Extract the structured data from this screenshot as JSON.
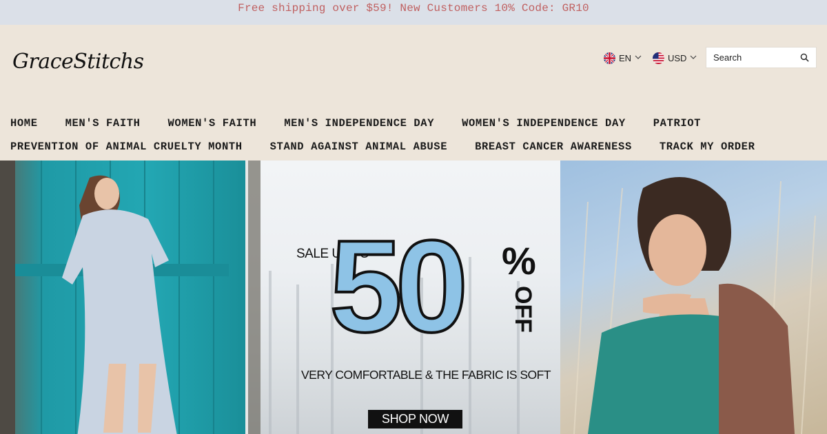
{
  "announcement": "Free shipping over $59! New Customers 10% Code: GR10",
  "brand": {
    "logo_text": "GraceStitchs"
  },
  "header": {
    "language": {
      "label": "EN",
      "flag_icon": "uk-flag-icon"
    },
    "currency": {
      "label": "USD",
      "flag_icon": "us-flag-icon"
    },
    "search": {
      "placeholder": "Search",
      "icon": "search-icon"
    }
  },
  "nav": {
    "row1": [
      "HOME",
      "MEN'S FAITH",
      "WOMEN'S FAITH",
      "MEN'S INDEPENDENCE DAY",
      "WOMEN'S INDEPENDENCE DAY",
      "PATRIOT"
    ],
    "row2": [
      "PREVENTION OF ANIMAL CRUELTY MONTH",
      "STAND AGAINST ANIMAL ABUSE",
      "BREAST CANCER AWARENESS",
      "TRACK MY ORDER"
    ]
  },
  "hero": {
    "sale_prefix": "SALE UP TO",
    "sale_value": "50",
    "sale_percent": "%",
    "sale_suffix": "OFF",
    "tagline": "VERY COMFORTABLE & THE FABRIC IS SOFT",
    "cta": "SHOP NOW"
  },
  "colors": {
    "announce_bg": "#dbe0e8",
    "announce_text": "#c06060",
    "header_bg": "#ede5da",
    "accent_blue": "#8ec3e6"
  }
}
